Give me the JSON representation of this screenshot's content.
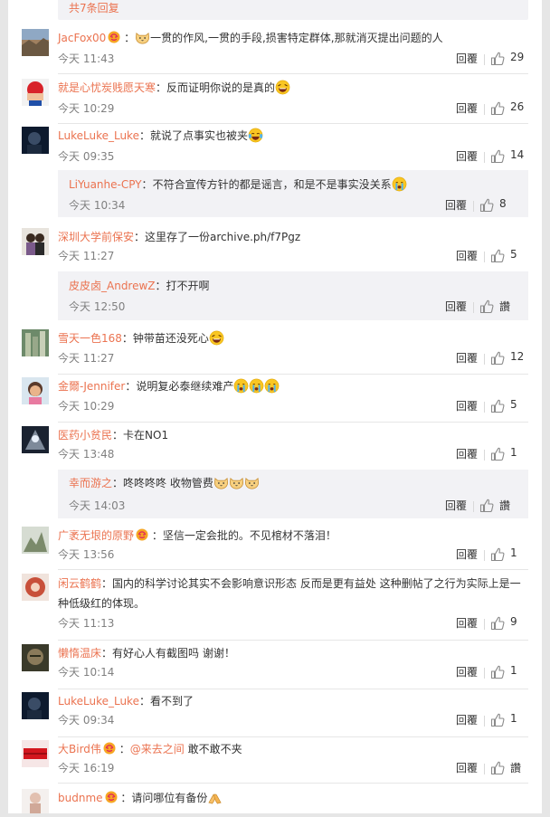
{
  "top_banner": {
    "text": "共7条回复"
  },
  "labels": {
    "reply": "回覆"
  },
  "colors": {
    "username": "#eb7350",
    "panel": "#f2f2f5",
    "time": "#808080"
  },
  "comments": [
    {
      "user": "JacFox00",
      "badge": true,
      "pre_emoji": "cat",
      "text": "一贯的作风,一贯的手段,损害特定群体,那就消灭提出问题的人",
      "time": "今天 11:43",
      "likes": "29"
    },
    {
      "user": "就是心忧炭贱愿天寒",
      "text": "反而证明你说的是真的",
      "post_emoji": "laugh",
      "time": "今天 10:29",
      "likes": "26"
    },
    {
      "user": "LukeLuke_Luke",
      "text": "就说了点事实也被夹",
      "post_emoji": "laugh-cry",
      "time": "今天 09:35",
      "likes": "14"
    },
    {
      "user": "LiYuanhe-CPY",
      "text": "不符合宣传方针的都是谣言，和是不是事实没关系",
      "post_emoji": "cry",
      "time": "今天 10:34",
      "likes": "8"
    },
    {
      "user": "深圳大学前保安",
      "text": "这里存了一份archive.ph/f7Pgz",
      "time": "今天 11:27",
      "likes": "5"
    },
    {
      "user": "皮皮卤_AndrewZ",
      "text": "打不开啊",
      "time": "今天 12:50",
      "likes": "讚"
    },
    {
      "user": "雪天一色168",
      "text": "钟带苗还没死心",
      "post_emoji": "laugh",
      "time": "今天 11:27",
      "likes": "12"
    },
    {
      "user": "金爾-Jennifer",
      "text": "说明复必泰继续难产",
      "post_emoji": "sob3",
      "time": "今天 10:29",
      "likes": "5"
    },
    {
      "user": "医药小贫民",
      "text": "卡在NO1",
      "time": "今天 13:48",
      "likes": "1"
    },
    {
      "user": "幸而游之",
      "text": "咚咚咚咚 收物管费",
      "post_emoji": "cat3",
      "time": "今天 14:03",
      "likes": "讚"
    },
    {
      "user": "广袤无垠的原野",
      "badge": true,
      "text": "坚信一定会批的。不见棺材不落泪！",
      "time": "今天 13:56",
      "likes": "1"
    },
    {
      "user": "闲云鹤鹤",
      "text": "国内的科学讨论其实不会影响意识形态 反而是更有益处 这种删帖了之行为实际上是一",
      "text2": "种低级红的体现。",
      "time": "今天 11:13",
      "likes": "9"
    },
    {
      "user": "懒惰温床",
      "text": "有好心人有截图吗 谢谢！",
      "time": "今天 10:14",
      "likes": "1"
    },
    {
      "user": "LukeLuke_Luke",
      "text": "看不到了",
      "time": "今天 09:34",
      "likes": "1"
    },
    {
      "user": "大Bird伟",
      "badge": true,
      "mention": "@来去之间",
      "text": " 敢不敢不夹",
      "time": "今天 16:19",
      "likes": "讚"
    },
    {
      "user": "budnme",
      "badge": true,
      "text": "请问哪位有备份",
      "post_emoji": "pray",
      "time": "",
      "likes": ""
    }
  ]
}
